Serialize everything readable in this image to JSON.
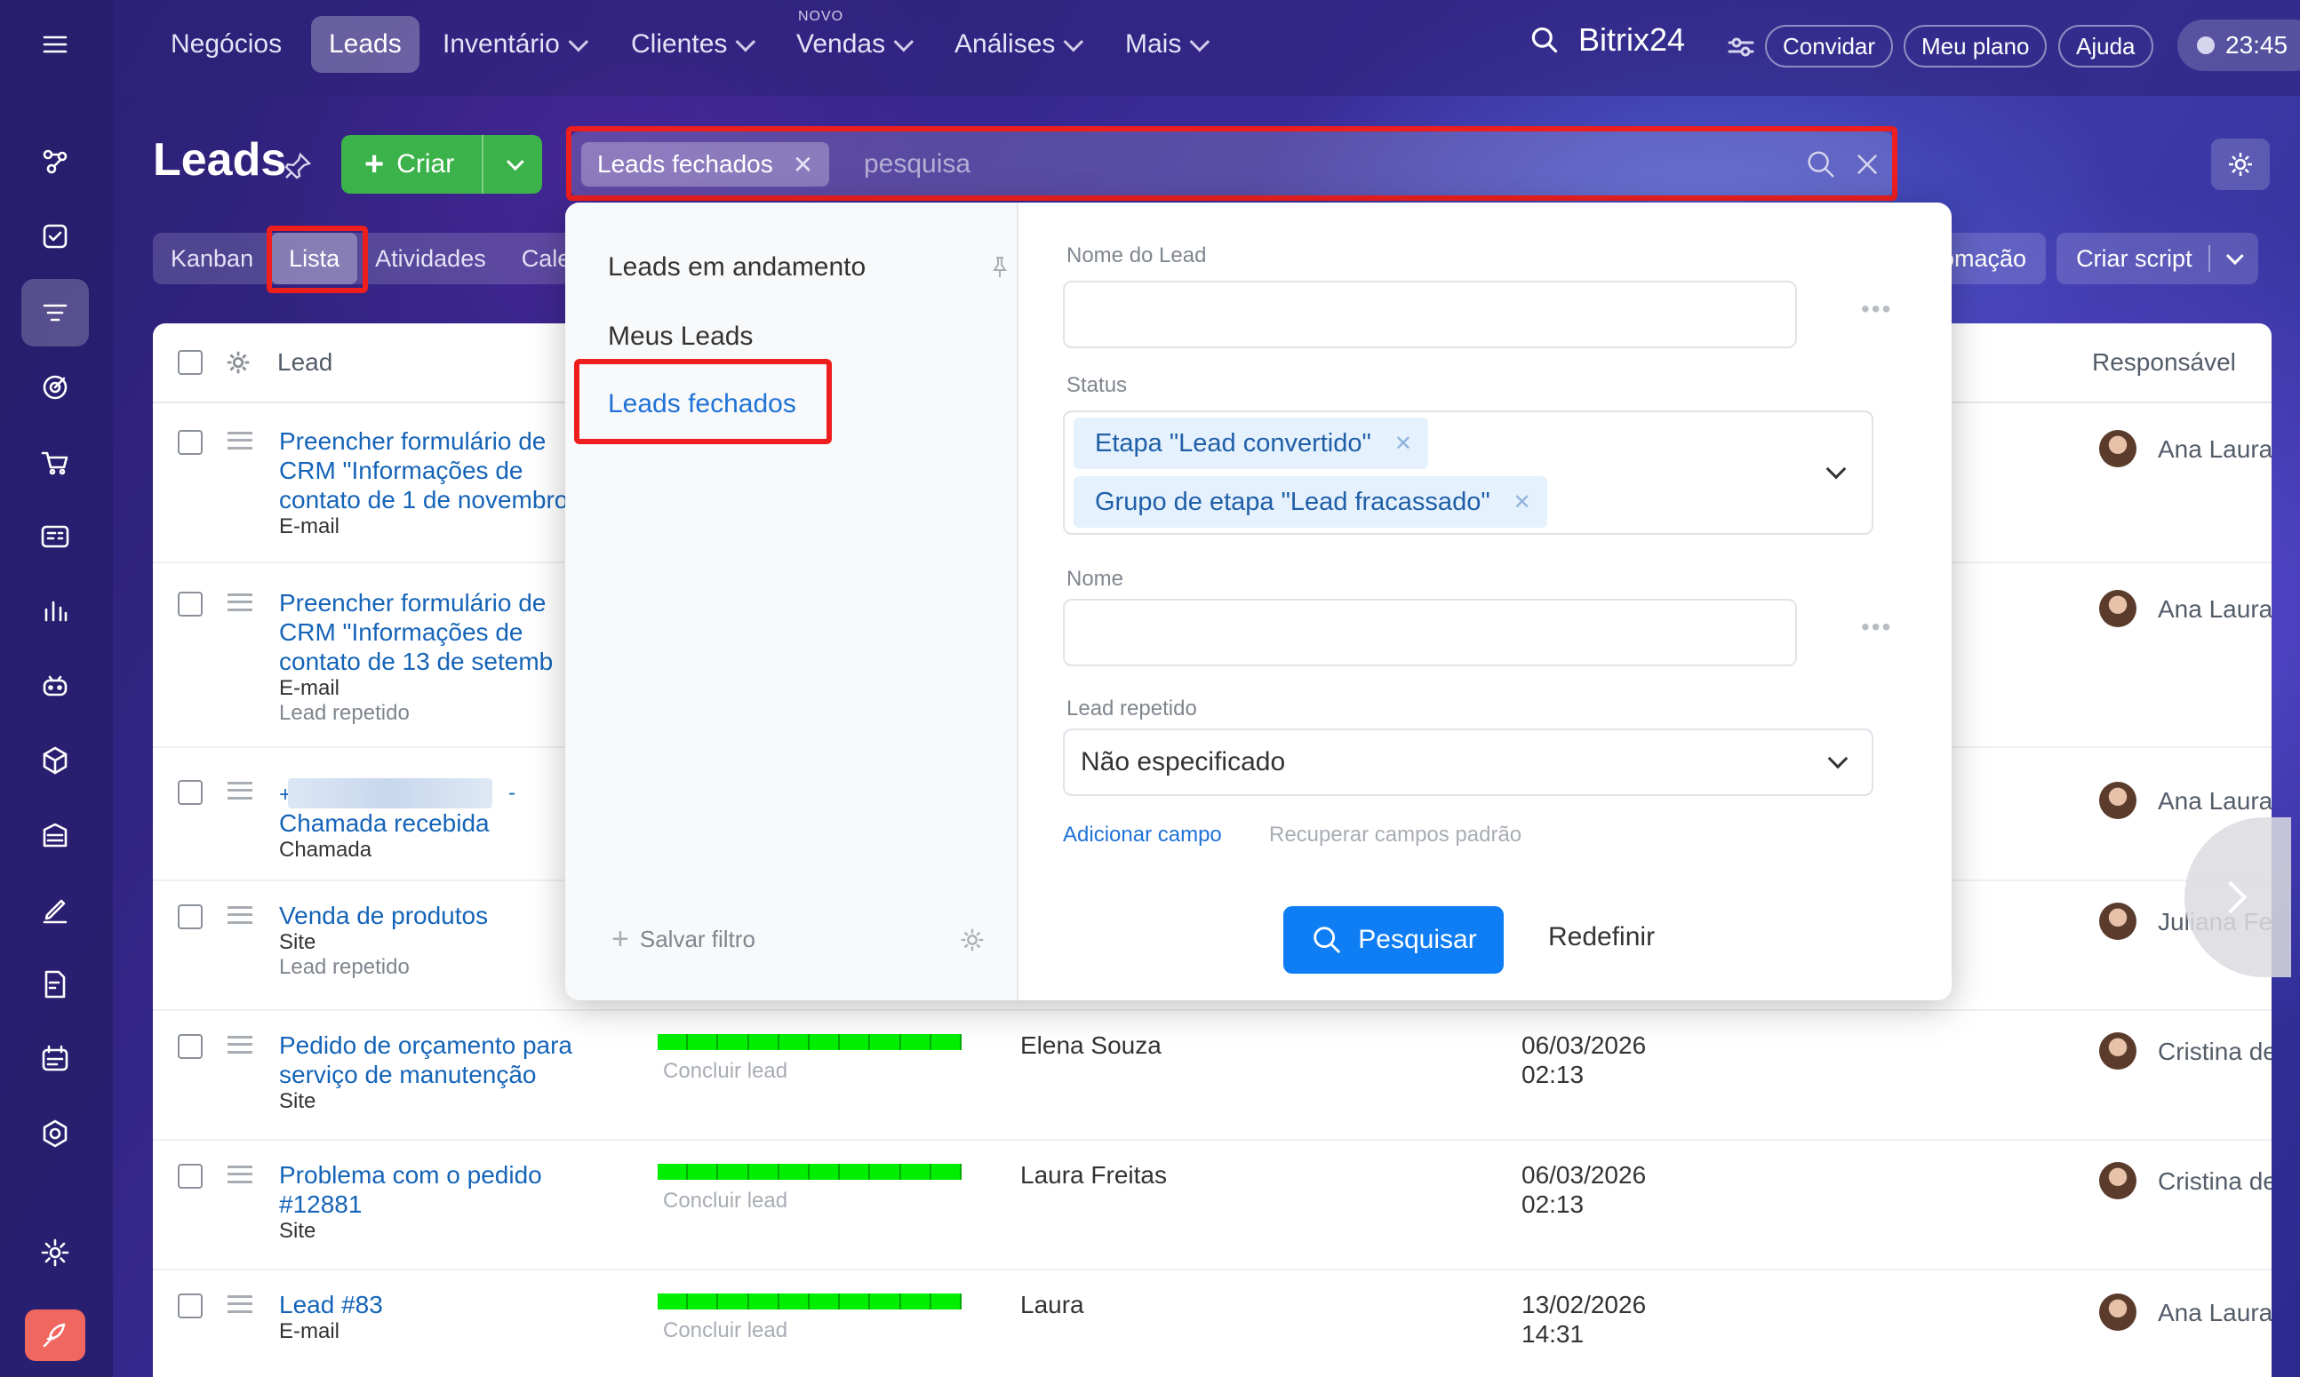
{
  "nav": {
    "items": [
      "Negócios",
      "Leads",
      "Inventário",
      "Clientes",
      "Vendas",
      "Análises",
      "Mais"
    ],
    "novo_badge": "NOVO",
    "brand": "Bitrix24",
    "invite": "Convidar",
    "plan": "Meu plano",
    "help": "Ajuda",
    "time": "23:45"
  },
  "page": {
    "title": "Leads",
    "create_label": "Criar",
    "filter_chip": "Leads fechados",
    "search_placeholder": "pesquisa"
  },
  "tabs": [
    "Kanban",
    "Lista",
    "Atividades",
    "Cale"
  ],
  "right_tabs": {
    "automation": "omação",
    "script": "Criar script"
  },
  "grid": {
    "headers": {
      "lead": "Lead",
      "responsible": "Responsável"
    },
    "rows": [
      {
        "title": "Preencher formulário de CRM \"Informações de contato de 1 de novembro",
        "source": "E-mail",
        "extra": "",
        "stage": "",
        "client": "",
        "date": "",
        "time": "",
        "responsible": "Ana Laura"
      },
      {
        "title": "Preencher formulário de CRM \"Informações de contato de 13 de setemb",
        "source": "E-mail",
        "extra": "Lead repetido",
        "stage": "",
        "client": "",
        "date": "",
        "time": "",
        "responsible": "Ana Laura"
      },
      {
        "title": "Chamada recebida",
        "source": "Chamada",
        "extra": "",
        "stage": "",
        "client": "",
        "date": "",
        "time": "",
        "responsible": "Ana Laura",
        "phone_prefix": "+",
        "phone_suffix": "-"
      },
      {
        "title": "Venda de produtos",
        "source": "Site",
        "extra": "Lead repetido",
        "stage": "",
        "client": "",
        "date": "",
        "time": "",
        "responsible": "Juliana Fe"
      },
      {
        "title": "Pedido de orçamento para serviço de manutenção",
        "source": "Site",
        "extra": "",
        "stage": "Concluir lead",
        "client": "Elena Souza",
        "date": "06/03/2026",
        "time": "02:13",
        "responsible": "Cristina de"
      },
      {
        "title": "Problema com o pedido #12881",
        "source": "Site",
        "extra": "",
        "stage": "Concluir lead",
        "client": "Laura Freitas",
        "date": "06/03/2026",
        "time": "02:13",
        "responsible": "Cristina de"
      },
      {
        "title": "Lead #83",
        "source": "E-mail",
        "extra": "",
        "stage": "Concluir lead",
        "client": "Laura",
        "date": "13/02/2026",
        "time": "14:31",
        "responsible": "Ana Laura"
      }
    ]
  },
  "filter": {
    "presets": [
      "Leads em andamento",
      "Meus Leads",
      "Leads fechados"
    ],
    "save_filter": "Salvar filtro",
    "fields": {
      "lead_name": "Nome do Lead",
      "status": "Status",
      "name": "Nome",
      "repeated": "Lead repetido"
    },
    "status_tags": [
      "Etapa \"Lead convertido\"",
      "Grupo de etapa \"Lead fracassado\""
    ],
    "repeated_value": "Não especificado",
    "add_field": "Adicionar campo",
    "restore_fields": "Recuperar campos padrão",
    "search_button": "Pesquisar",
    "reset_button": "Redefinir"
  }
}
